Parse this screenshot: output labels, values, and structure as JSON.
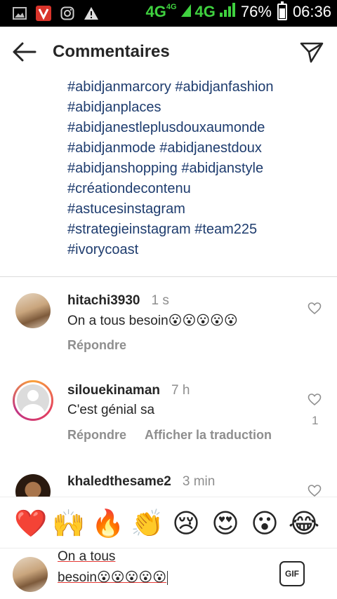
{
  "status_bar": {
    "network_1": "4G",
    "network_1_sup": "4G",
    "network_2": "4G",
    "battery": "76%",
    "time": "06:36"
  },
  "header": {
    "title": "Commentaires"
  },
  "caption": {
    "lines": [
      "#abidjanmarcory #abidjanfashion",
      "#abidjanplaces",
      "#abidjanestleplusdouxaumonde",
      "#abidjanmode #abidjanestdoux",
      "#abidjanshopping #abidjanstyle",
      "#créationdecontenu",
      "#astucesinstagram",
      "#strategieinstagram #team225",
      "#ivorycoast"
    ]
  },
  "comments": [
    {
      "username": "hitachi3930",
      "time": "1 s",
      "text": "On a tous besoin😮😮😮😮😮",
      "reply": "Répondre"
    },
    {
      "username": "silouekinaman",
      "time": "7 h",
      "text": "C'est génial sa",
      "reply": "Répondre",
      "translate": "Afficher la traduction",
      "likes": "1"
    },
    {
      "username": "khaledthesame2",
      "time": "3 min"
    }
  ],
  "emoji_bar": [
    "❤️",
    "🙌",
    "🔥",
    "👏",
    "😢",
    "😍",
    "😮",
    "😂"
  ],
  "input": {
    "line1": "On a tous",
    "line2": "besoin😮😮😮😮😮",
    "gif_label": "GIF"
  },
  "colors": {
    "hashtag": "#1e3c6e",
    "muted": "#8e8e8e",
    "network": "#3fd13f"
  }
}
